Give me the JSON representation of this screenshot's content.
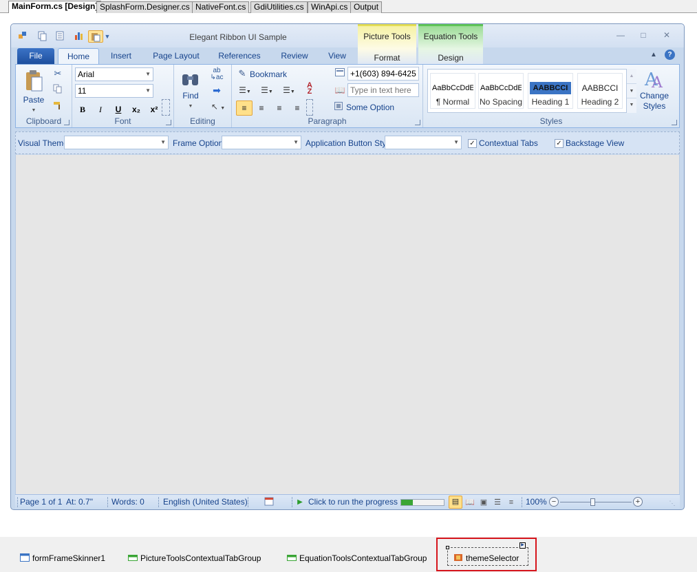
{
  "ide": {
    "doc_tabs": [
      "MainForm.cs [Design]",
      "SplashForm.Designer.cs",
      "NativeFont.cs",
      "GdiUtilities.cs",
      "WinApi.cs",
      "Output"
    ]
  },
  "window": {
    "title": "Elegant Ribbon UI Sample",
    "qat_icons": [
      "quick-access-app-icon",
      "copy-icon",
      "document-icon",
      "chart-icon",
      "paste-icon",
      "qat-dropdown-icon"
    ],
    "min_glyph": "—",
    "max_glyph": "□",
    "close_glyph": "✕"
  },
  "contextual": {
    "picture": {
      "title": "Picture Tools",
      "tab": "Format",
      "color": "#f3f08a"
    },
    "equation": {
      "title": "Equation Tools",
      "tab": "Design",
      "color": "#8fd98a"
    }
  },
  "ribbon": {
    "file_tab": "File",
    "tabs": [
      "Home",
      "Insert",
      "Page Layout",
      "References",
      "Review",
      "View"
    ],
    "groups": {
      "clipboard": {
        "label": "Clipboard",
        "paste": "Paste"
      },
      "font": {
        "label": "Font",
        "font_name": "Arial",
        "font_size": "11",
        "bold": "B",
        "italic": "I",
        "underline": "U",
        "subscript": "x₂",
        "superscript": "x²"
      },
      "editing": {
        "label": "Editing",
        "find": "Find"
      },
      "paragraph": {
        "label": "Paragraph",
        "bookmark": "Bookmark",
        "phone": "+1(603) 894-6425",
        "input_placeholder": "Type in text here",
        "some_option": "Some Option"
      },
      "styles": {
        "label": "Styles",
        "items": [
          {
            "preview": "AaBbCcDdE",
            "name": "¶ Normal"
          },
          {
            "preview": "AaBbCcDdE",
            "name": "No Spacing"
          },
          {
            "preview": "AABBCCI",
            "name": "Heading 1"
          },
          {
            "preview": "AABBCCI",
            "name": "Heading 2"
          }
        ],
        "change_styles": "Change Styles"
      }
    }
  },
  "options_bar": {
    "visual_theme": "Visual Theme",
    "frame_options": "Frame Options",
    "app_button_style": "Application Button Style",
    "contextual_tabs": "Contextual Tabs",
    "backstage_view": "Backstage View",
    "contextual_tabs_checked": true,
    "backstage_view_checked": true
  },
  "status_bar": {
    "page": "Page 1 of 1",
    "at": "At: 0.7\"",
    "words": "Words: 0",
    "language": "English (United States)",
    "progress_text": "Click to run the progress",
    "progress_fraction": 0.28,
    "zoom": "100%"
  },
  "tray": {
    "items": [
      "formFrameSkinner1",
      "PictureToolsContextualTabGroup",
      "EquationToolsContextualTabGroup",
      "themeSelector"
    ]
  }
}
